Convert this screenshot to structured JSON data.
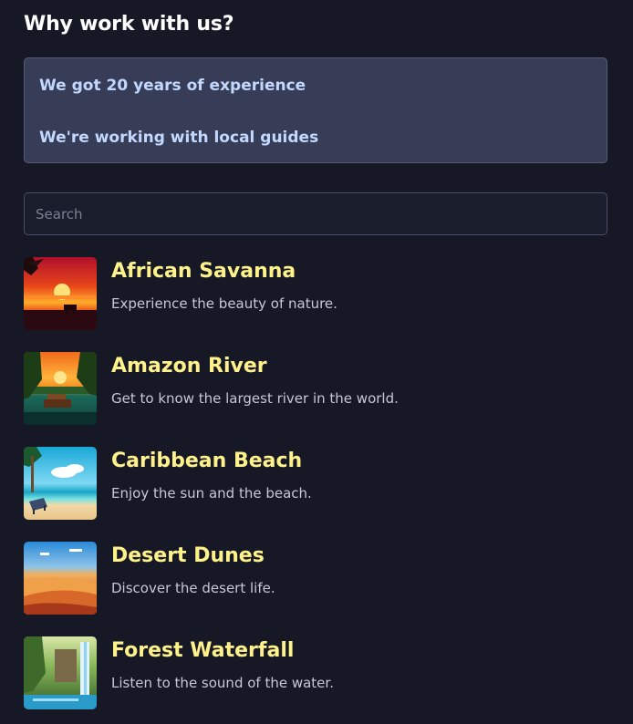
{
  "section": {
    "title": "Why work with us?",
    "reasons": [
      "We got 20 years of experience",
      "We're working with local guides"
    ]
  },
  "search": {
    "placeholder": "Search",
    "value": ""
  },
  "destinations": [
    {
      "title": "African Savanna",
      "description": "Experience the beauty of nature.",
      "image": "savanna-sunset-image"
    },
    {
      "title": "Amazon River",
      "description": "Get to know the largest river in the world.",
      "image": "river-boat-image"
    },
    {
      "title": "Caribbean Beach",
      "description": "Enjoy the sun and the beach.",
      "image": "beach-chair-image"
    },
    {
      "title": "Desert Dunes",
      "description": "Discover the desert life.",
      "image": "desert-dunes-image"
    },
    {
      "title": "Forest Waterfall",
      "description": "Listen to the sound of the water.",
      "image": "waterfall-image"
    }
  ],
  "colors": {
    "background": "#161925",
    "card": "#373d57",
    "reason_text": "#c3d8ff",
    "destination_title": "#fff28a",
    "destination_text": "#c6c9d4"
  }
}
